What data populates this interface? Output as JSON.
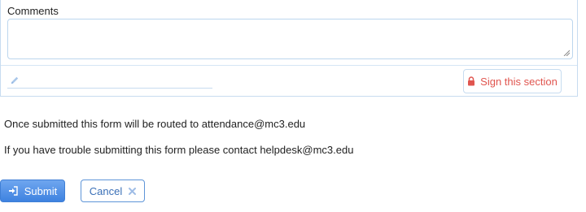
{
  "form": {
    "comments_label": "Comments",
    "comments_value": "",
    "sign_button_label": "Sign this section"
  },
  "info": {
    "routing_text": "Once submitted this form will be routed to attendance@mc3.edu",
    "help_text": "If you have trouble submitting this form please contact helpdesk@mc3.edu"
  },
  "actions": {
    "submit_label": "Submit",
    "cancel_label": "Cancel"
  },
  "colors": {
    "accent_blue": "#3e82e0",
    "sign_red": "#e0554f",
    "border_light_blue": "#c7dcf0"
  },
  "icons": {
    "signature": "pencil-icon",
    "sign_button": "lock-icon",
    "submit": "sign-in-icon",
    "cancel": "close-icon"
  }
}
